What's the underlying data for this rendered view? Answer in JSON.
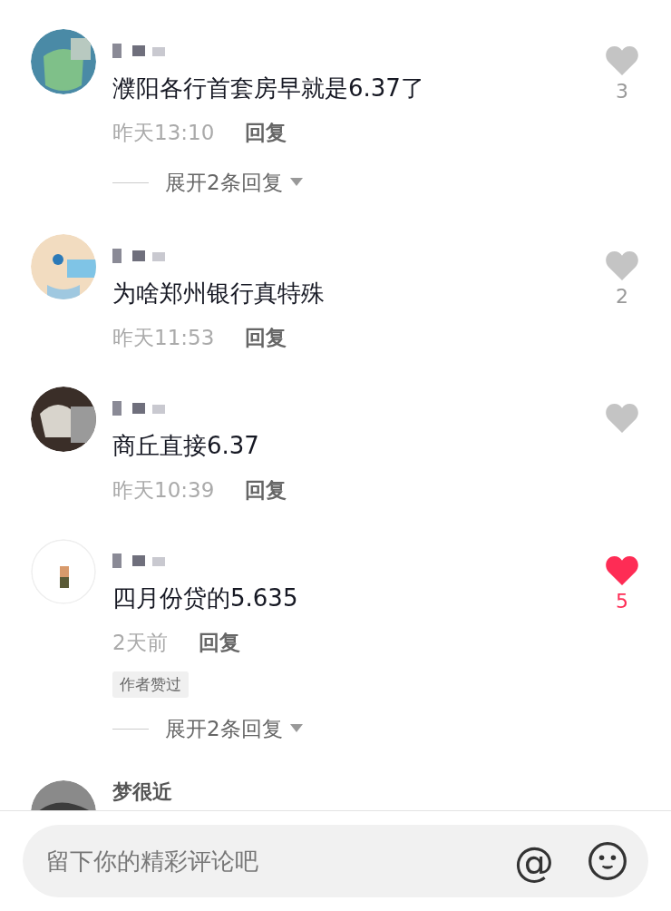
{
  "comments": [
    {
      "text": "濮阳各行首套房早就是6.37了",
      "time": "昨天13:10",
      "reply": "回复",
      "liked": false,
      "likes": "3",
      "expand": "展开2条回复"
    },
    {
      "text": "为啥郑州银行真特殊",
      "time": "昨天11:53",
      "reply": "回复",
      "liked": false,
      "likes": "2"
    },
    {
      "text": "商丘直接6.37",
      "time": "昨天10:39",
      "reply": "回复",
      "liked": false
    },
    {
      "text": "四月份贷的5.635",
      "time": "2天前",
      "reply": "回复",
      "liked": true,
      "likes": "5",
      "badge": "作者赞过",
      "expand": "展开2条回复"
    },
    {
      "name": "梦很近"
    }
  ],
  "input": {
    "placeholder": "留下你的精彩评论吧",
    "mention": "@"
  }
}
